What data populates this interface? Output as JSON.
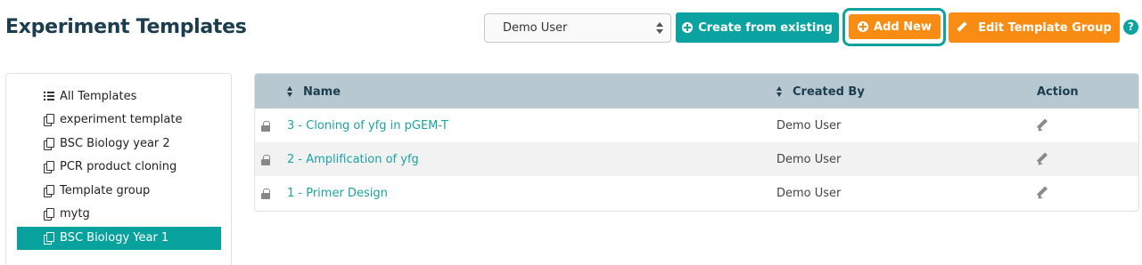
{
  "page": {
    "title": "Experiment Templates"
  },
  "toolbar": {
    "user_select_value": "Demo User",
    "create_from_existing_label": "Create from existing",
    "add_new_label": "Add New",
    "edit_group_label": "Edit Template Group",
    "help_label": "?"
  },
  "sidebar": {
    "items": [
      {
        "label": "All Templates",
        "icon": "list-icon"
      },
      {
        "label": "experiment template",
        "icon": "copy-icon"
      },
      {
        "label": "BSC Biology year 2",
        "icon": "copy-icon"
      },
      {
        "label": "PCR product cloning",
        "icon": "copy-icon"
      },
      {
        "label": "Template group",
        "icon": "copy-icon"
      },
      {
        "label": "mytg",
        "icon": "copy-icon"
      },
      {
        "label": "BSC Biology Year 1",
        "icon": "copy-icon",
        "active": true
      }
    ]
  },
  "table": {
    "headers": {
      "name": "Name",
      "created_by": "Created By",
      "action": "Action"
    },
    "rows": [
      {
        "name": "3 - Cloning of yfg in pGEM-T",
        "created_by": "Demo User"
      },
      {
        "name": "2 - Amplification of yfg",
        "created_by": "Demo User"
      },
      {
        "name": "1 - Primer Design",
        "created_by": "Demo User"
      }
    ]
  },
  "colors": {
    "teal": "#0aa3a1",
    "orange": "#f98d14",
    "title": "#1c3d4f",
    "header_bg": "#b8c8d0"
  }
}
